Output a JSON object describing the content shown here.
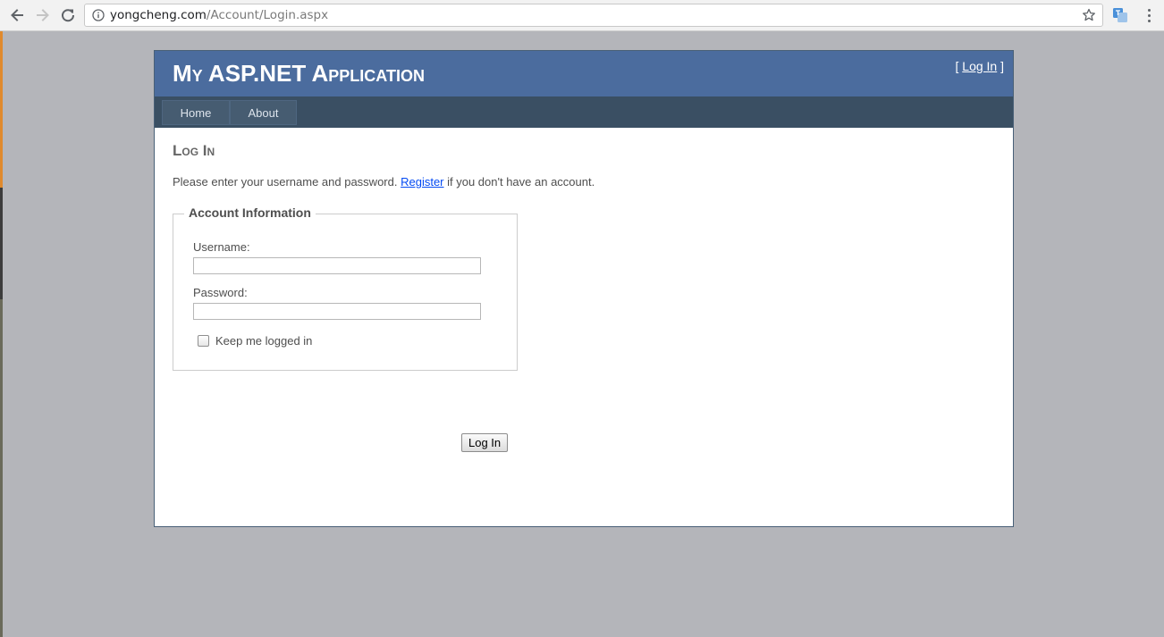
{
  "browser": {
    "url_host": "yongcheng.com",
    "url_path": "/Account/Login.aspx"
  },
  "header": {
    "site_title": "My ASP.NET Application",
    "login_prefix": "[ ",
    "login_link": "Log In",
    "login_suffix": " ]"
  },
  "menu": {
    "items": [
      {
        "label": "Home"
      },
      {
        "label": "About"
      }
    ]
  },
  "main": {
    "heading": "Log In",
    "intro_before": "Please enter your username and password. ",
    "register_link": "Register",
    "intro_after": " if you don't have an account.",
    "fieldset_legend": "Account Information",
    "username_label": "Username:",
    "username_value": "",
    "password_label": "Password:",
    "password_value": "",
    "remember_label": "Keep me logged in",
    "remember_checked": false,
    "submit_label": "Log In"
  },
  "colors": {
    "header_bg": "#4b6c9e",
    "menu_bg": "#3a4f63",
    "menu_item_bg": "#465c71",
    "link": "#034af3",
    "body_bg": "#b4b5ba"
  },
  "icons": {
    "back": "arrow-left",
    "forward": "arrow-right",
    "reload": "reload",
    "site_info": "info-circle",
    "bookmark": "star-outline",
    "extension": "translate-extension",
    "browser_menu": "vertical-dots"
  }
}
